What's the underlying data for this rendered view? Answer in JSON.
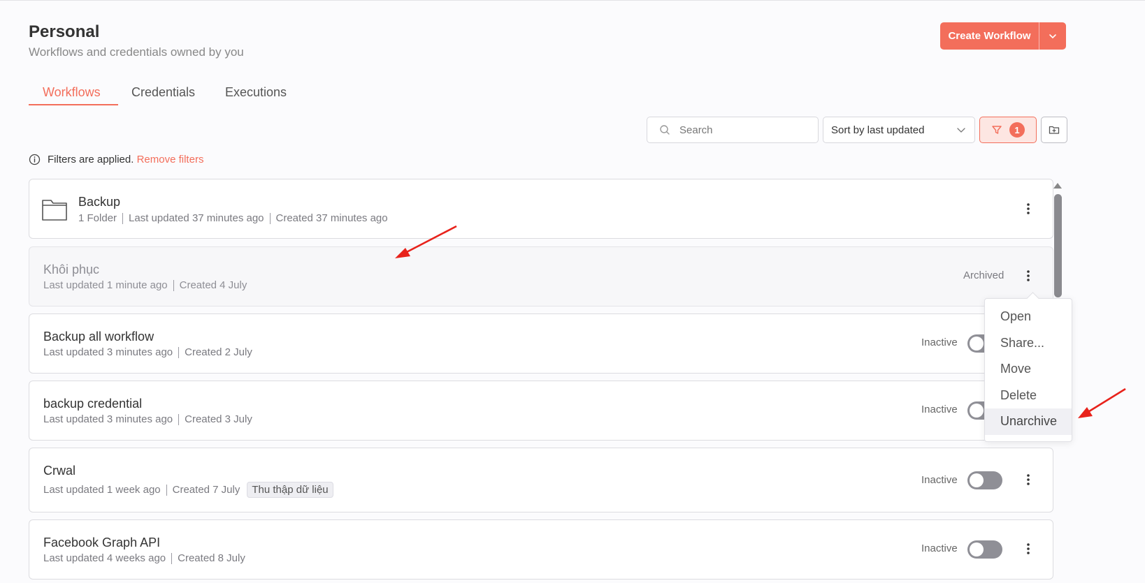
{
  "header": {
    "title": "Personal",
    "subtitle": "Workflows and credentials owned by you",
    "create_label": "Create Workflow"
  },
  "tabs": [
    {
      "label": "Workflows",
      "active": true
    },
    {
      "label": "Credentials",
      "active": false
    },
    {
      "label": "Executions",
      "active": false
    }
  ],
  "toolbar": {
    "search_placeholder": "Search",
    "sort_value": "Sort by last updated",
    "filter_count": "1"
  },
  "filters_note": {
    "text": "Filters are applied.",
    "remove_label": "Remove filters"
  },
  "folder": {
    "name": "Backup",
    "meta": [
      "1 Folder",
      "Last updated 37 minutes ago",
      "Created 37 minutes ago"
    ]
  },
  "workflows": [
    {
      "name": "Khôi phục",
      "meta": [
        "Last updated 1 minute ago",
        "Created 4 July"
      ],
      "status": "Archived",
      "archived": true
    },
    {
      "name": "Backup all workflow",
      "meta": [
        "Last updated 3 minutes ago",
        "Created 2 July"
      ],
      "status": "Inactive"
    },
    {
      "name": "backup credential",
      "meta": [
        "Last updated 3 minutes ago",
        "Created 3 July"
      ],
      "status": "Inactive"
    },
    {
      "name": "Crwal",
      "meta": [
        "Last updated 1 week ago",
        "Created 7 July"
      ],
      "tag": "Thu thập dữ liệu",
      "status": "Inactive"
    },
    {
      "name": "Facebook Graph API",
      "meta": [
        "Last updated 4 weeks ago",
        "Created 8 July"
      ],
      "status": "Inactive"
    }
  ],
  "context_menu": {
    "items": [
      "Open",
      "Share...",
      "Move",
      "Delete",
      "Unarchive"
    ],
    "hovered": "Unarchive"
  },
  "colors": {
    "accent": "#f36e5b",
    "annotation_arrow": "#e8221b"
  },
  "icons": [
    "search-icon",
    "chevron-down-icon",
    "filter-icon",
    "folder-plus-icon",
    "info-icon",
    "folder-icon",
    "kebab-menu-icon"
  ]
}
